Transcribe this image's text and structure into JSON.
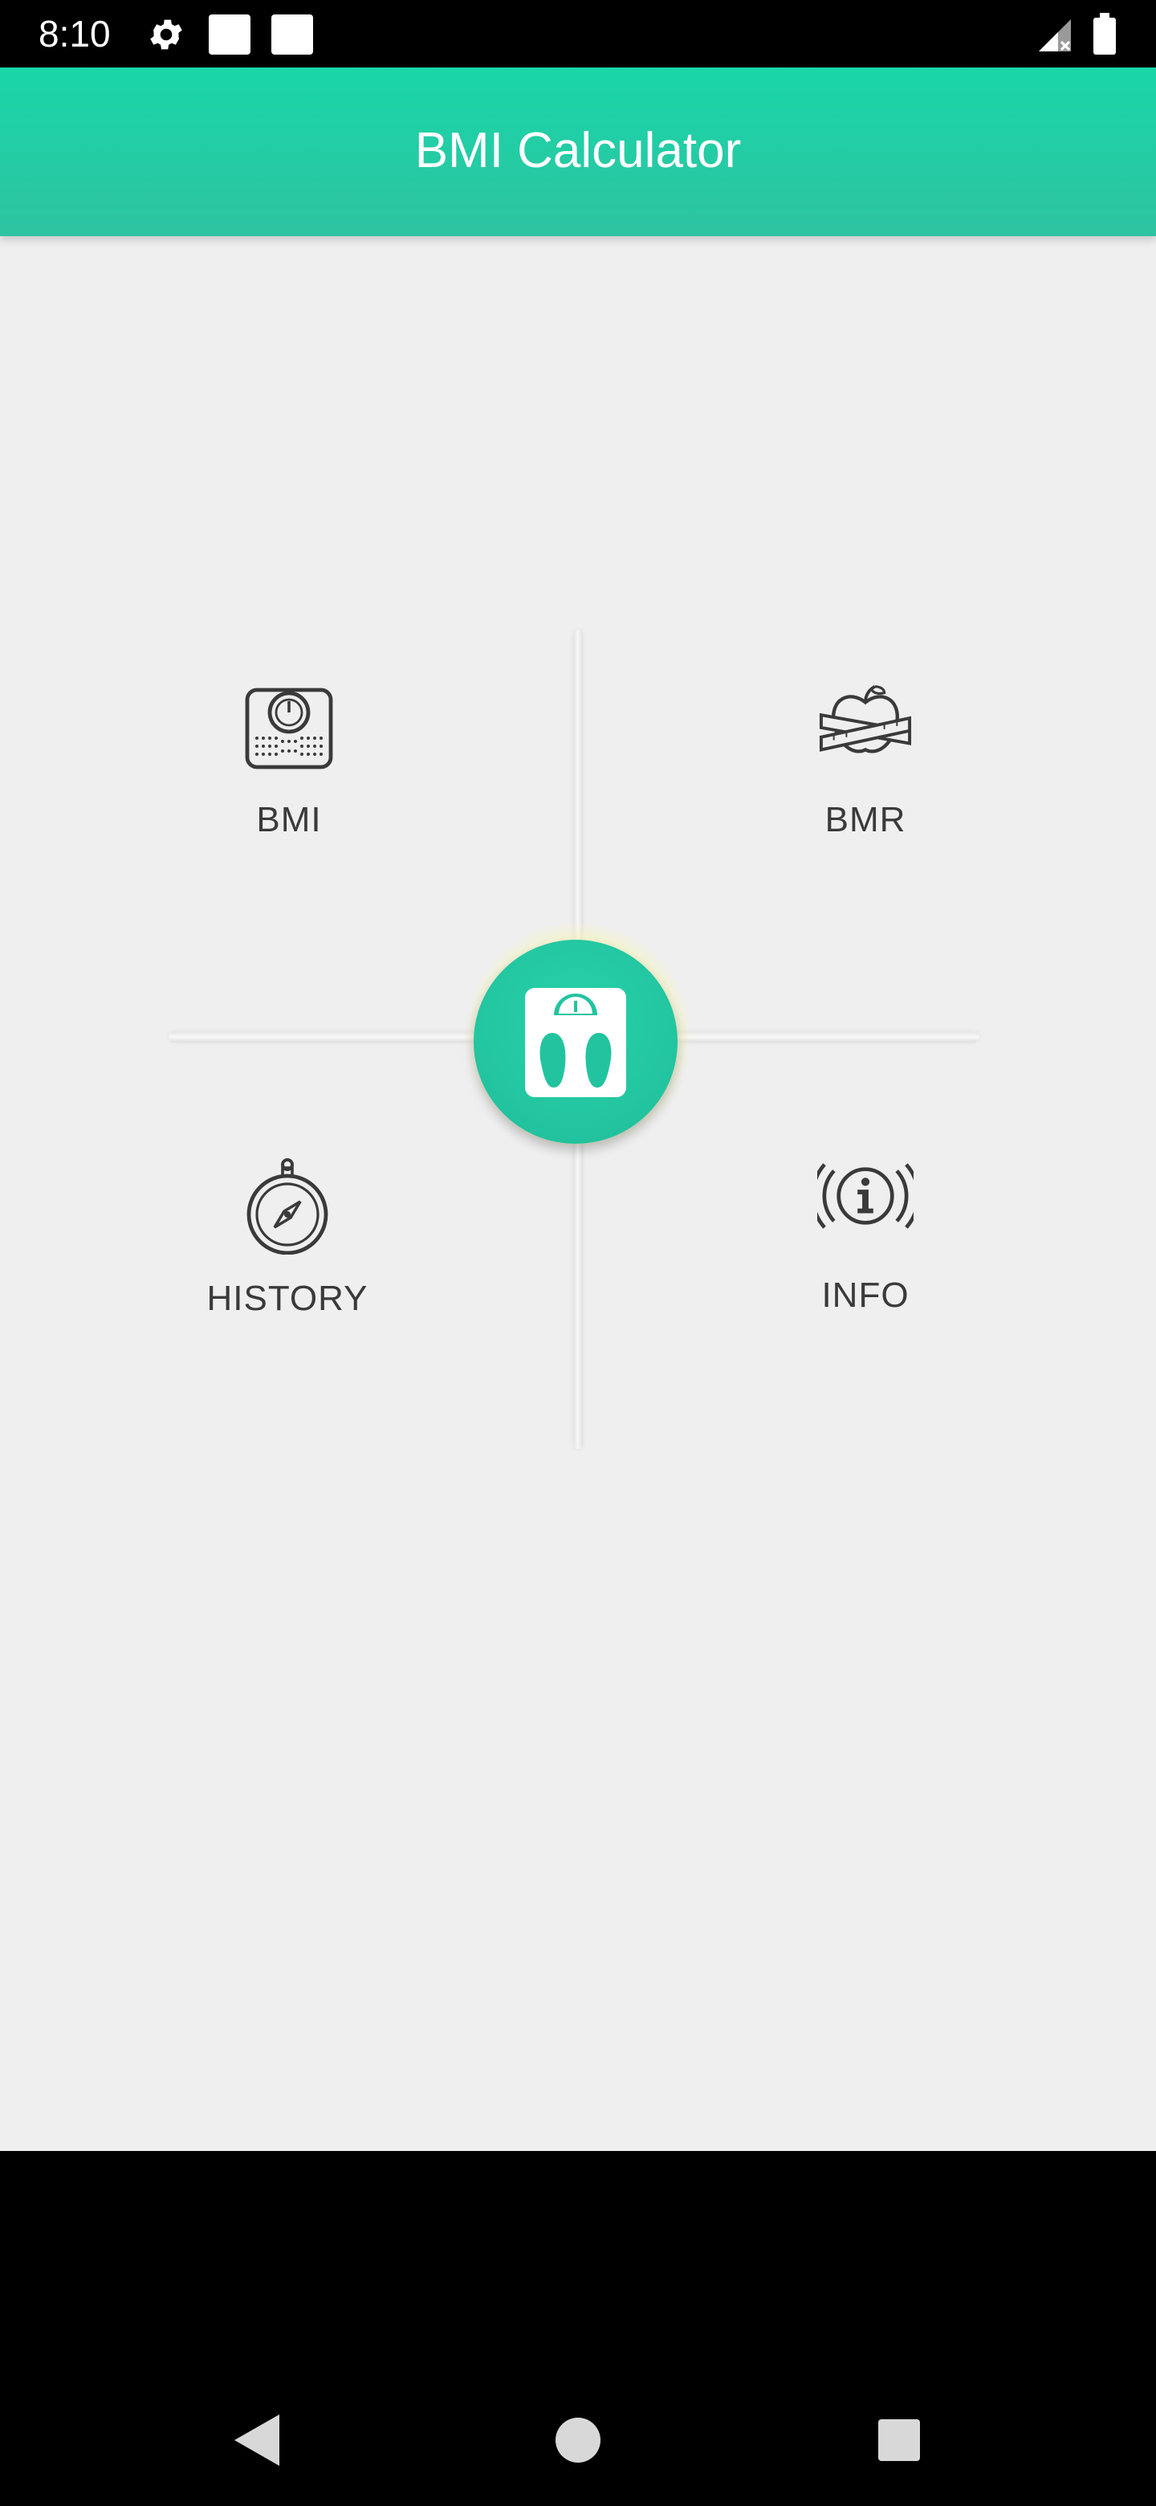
{
  "status_bar": {
    "time": "8:10",
    "icons": [
      "gear-icon",
      "notification-square-icon",
      "notification-square-icon",
      "signal-icon",
      "battery-icon"
    ]
  },
  "app_bar": {
    "title": "BMI Calculator",
    "color_top": "#19d6a8",
    "color_bottom": "#2ec3a1"
  },
  "menu": {
    "items": [
      {
        "label": "BMI",
        "icon": "scale-dial-icon"
      },
      {
        "label": "BMR",
        "icon": "apple-tape-measure-icon"
      },
      {
        "label": "HISTORY",
        "icon": "compass-icon"
      },
      {
        "label": "INFO",
        "icon": "info-icon"
      }
    ],
    "center_icon": "bathroom-scale-icon",
    "accent": "#22c49f"
  },
  "nav_bar": {
    "buttons": [
      "back-icon",
      "home-icon",
      "recents-icon"
    ]
  }
}
